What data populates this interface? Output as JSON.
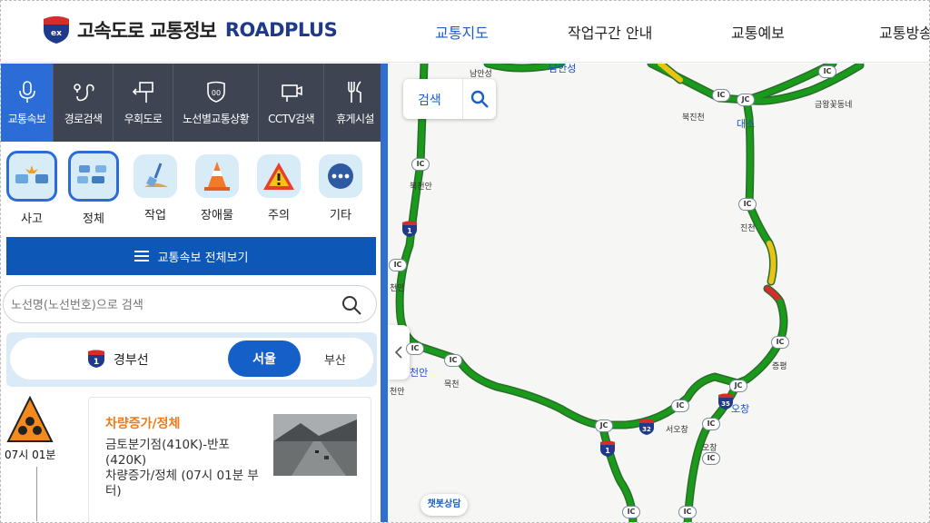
{
  "header": {
    "logo_kr": "고속도로 교통정보",
    "logo_en": "ROADPLUS",
    "logo_badge_text": "ex",
    "nav": [
      {
        "label": "교통지도",
        "active": true
      },
      {
        "label": "작업구간 안내",
        "active": false
      },
      {
        "label": "교통예보",
        "active": false
      },
      {
        "label": "교통방송",
        "active": false
      }
    ]
  },
  "menu": [
    {
      "label": "교통속보",
      "icon": "microphone-icon",
      "active": true
    },
    {
      "label": "경로검색",
      "icon": "route-icon",
      "active": false
    },
    {
      "label": "우회도로",
      "icon": "detour-sign-icon",
      "active": false
    },
    {
      "label": "노선별교통상황",
      "icon": "highway-shield-icon",
      "active": false
    },
    {
      "label": "CCTV검색",
      "icon": "cctv-icon",
      "active": false
    },
    {
      "label": "휴게시설",
      "icon": "fork-knife-icon",
      "active": false
    }
  ],
  "categories": [
    {
      "label": "사고",
      "icon": "accident-icon",
      "selected": true
    },
    {
      "label": "정체",
      "icon": "congestion-icon",
      "selected": true
    },
    {
      "label": "작업",
      "icon": "shovel-icon",
      "selected": false
    },
    {
      "label": "장애물",
      "icon": "traffic-cone-icon",
      "selected": false
    },
    {
      "label": "주의",
      "icon": "warning-icon",
      "selected": false
    },
    {
      "label": "기타",
      "icon": "more-icon",
      "selected": false
    }
  ],
  "all_view_label": "교통속보 전체보기",
  "search": {
    "placeholder": "노선명(노선번호)으로 검색"
  },
  "route": {
    "shield_number": "1",
    "name": "경부선",
    "direction_selected": "서울",
    "direction_other": "부산"
  },
  "incident": {
    "time": "07시 01분",
    "title": "차량증가/정체",
    "location": "금토분기점(410K)-반포(420K)",
    "detail": "차량증가/정체 (07시 01분 부터)"
  },
  "map": {
    "search_label": "검색",
    "chatbot_label": "챗봇상담",
    "ic_label": "IC",
    "jc_label": "JC",
    "place_labels": {
      "namanseong": "남안성",
      "namanseong_blue": "남안성",
      "bukjincheon": "북진천",
      "bukjincheon_blue": "대소",
      "geumwang": "금왕꽃동네",
      "bukcheonan": "북천안",
      "jincheon": "진천",
      "cheonan": "천안",
      "cheonan_blue": "천안",
      "cheonan2": "천안",
      "jeungpyeong": "증평",
      "ochang_blue": "오창",
      "seoochang": "서오창",
      "ochang": "오창",
      "mokcheon": "목천",
      "daeso": "대소"
    },
    "shields": {
      "n1": "1",
      "n32": "32",
      "n35": "35"
    },
    "colors": {
      "free": "#1a9a1a",
      "slow": "#e8c417",
      "jam": "#d92b2b",
      "road_outline": "#2b6b2b"
    }
  }
}
